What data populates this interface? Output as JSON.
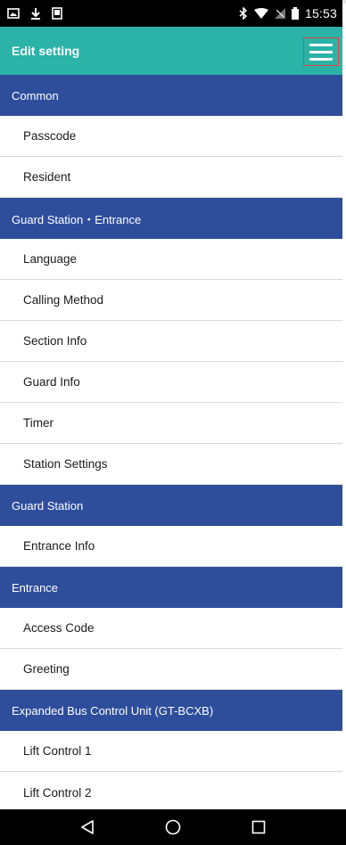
{
  "status_bar": {
    "left_icons": [
      "image-icon",
      "download-icon",
      "phone-icon"
    ],
    "right_icons": [
      "bluetooth-icon",
      "wifi-icon",
      "no-signal-icon",
      "battery-icon"
    ],
    "time": "15:53"
  },
  "header": {
    "title": "Edit setting",
    "menu_icon": "hamburger-menu-icon",
    "background_color": "#2bb3a8",
    "highlight_color": "#d9443a"
  },
  "section_color": "#2e4d9b",
  "sections": [
    {
      "title": "Common",
      "items": [
        "Passcode",
        "Resident"
      ]
    },
    {
      "title": "Guard Station・Entrance",
      "items": [
        "Language",
        "Calling Method",
        "Section Info",
        "Guard Info",
        "Timer",
        "Station Settings"
      ]
    },
    {
      "title": "Guard Station",
      "items": [
        "Entrance Info"
      ]
    },
    {
      "title": "Entrance",
      "items": [
        "Access Code",
        "Greeting"
      ]
    },
    {
      "title": "Expanded Bus Control Unit (GT-BCXB)",
      "items": [
        "Lift Control 1",
        "Lift Control 2"
      ]
    }
  ],
  "nav_bar": {
    "icons": [
      "back-icon",
      "home-icon",
      "recents-icon"
    ]
  }
}
